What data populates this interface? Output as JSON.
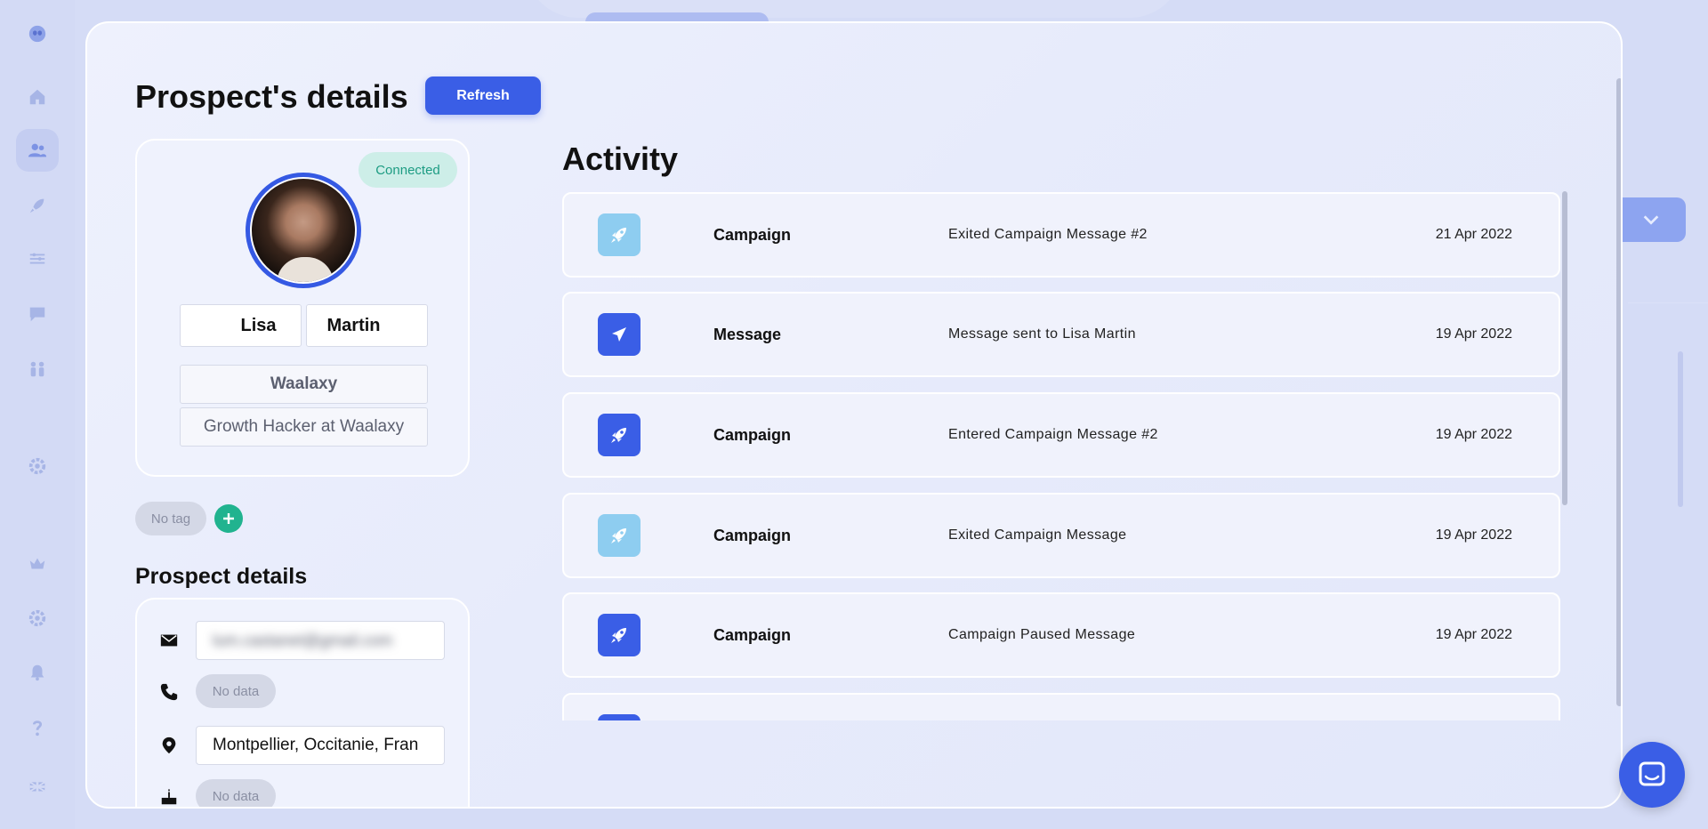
{
  "modal": {
    "title": "Prospect's details",
    "refresh_label": "Refresh"
  },
  "profile": {
    "status_badge": "Connected",
    "first_name": "Lisa",
    "last_name": "Martin",
    "company": "Waalaxy",
    "job_title": "Growth Hacker at Waalaxy",
    "avatar": "avatar-photo"
  },
  "tags": {
    "no_tag_label": "No tag",
    "add_icon": "plus-icon"
  },
  "details": {
    "section_title": "Prospect details",
    "email_value": "lum.castanet@gmail.com",
    "phone_value": "No data",
    "location_value": "Montpellier, Occitanie, Fran",
    "birthday_value": "No data"
  },
  "activity": {
    "title": "Activity",
    "rows": [
      {
        "type": "Campaign",
        "description": "Exited Campaign Message #2",
        "date": "21 Apr 2022",
        "icon": "rocket-icon",
        "icon_color": "#8ecdf0"
      },
      {
        "type": "Message",
        "description": "Message sent to Lisa Martin",
        "date": "19 Apr 2022",
        "icon": "send-icon",
        "icon_color": "#3a5ee6"
      },
      {
        "type": "Campaign",
        "description": "Entered Campaign Message #2",
        "date": "19 Apr 2022",
        "icon": "rocket-icon",
        "icon_color": "#3a5ee6"
      },
      {
        "type": "Campaign",
        "description": "Exited Campaign Message",
        "date": "19 Apr 2022",
        "icon": "rocket-icon",
        "icon_color": "#8ecdf0"
      },
      {
        "type": "Campaign",
        "description": "Campaign Paused Message",
        "date": "19 Apr 2022",
        "icon": "rocket-icon",
        "icon_color": "#3a5ee6"
      }
    ]
  },
  "colors": {
    "accent": "#3a5ee6",
    "connected": "#1d9c83",
    "add_tag": "#21b38f"
  }
}
